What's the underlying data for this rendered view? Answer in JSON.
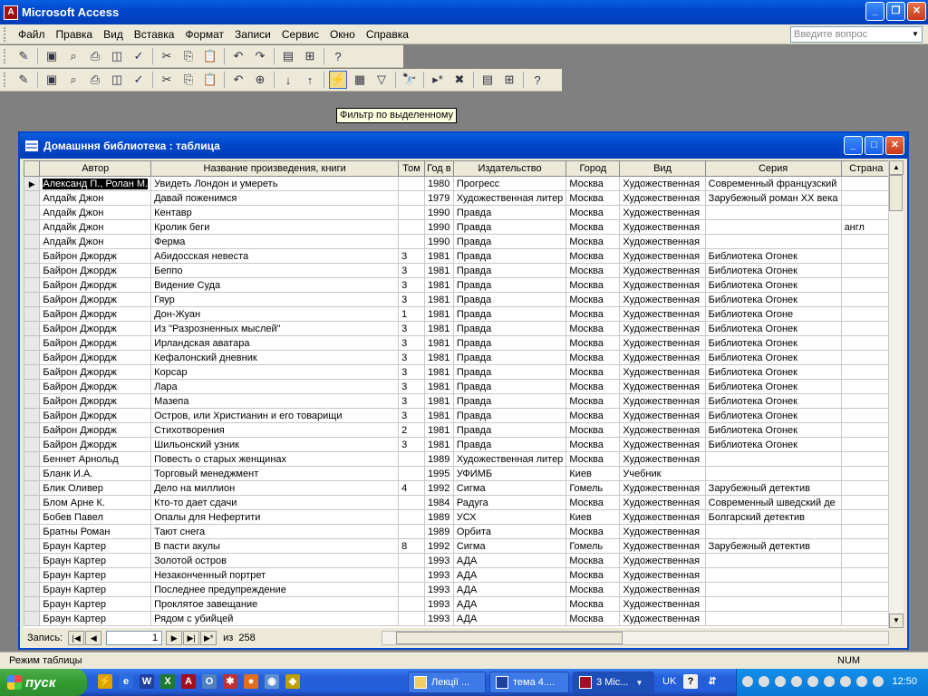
{
  "app": {
    "title": "Microsoft Access"
  },
  "menu": [
    "Файл",
    "Правка",
    "Вид",
    "Вставка",
    "Формат",
    "Записи",
    "Сервис",
    "Окно",
    "Справка"
  ],
  "ask": {
    "placeholder": "Введите вопрос"
  },
  "tooltip": "Фильтр по выделенному",
  "table_window": {
    "title": "Домашння библиотека : таблица"
  },
  "columns": [
    "Автор",
    "Название произведения, книги",
    "Том",
    "Год в",
    "Издательство",
    "Город",
    "Вид",
    "Серия",
    "Страна"
  ],
  "rows": [
    [
      "Александ П., Ролан М.",
      "Увидеть Лондон и умереть",
      "",
      "1980",
      "Прогресс",
      "Москва",
      "Художественная",
      "Современный французский",
      ""
    ],
    [
      "Апдайк Джон",
      "Давай поженимся",
      "",
      "1979",
      "Художественная литер",
      "Москва",
      "Художественная",
      "Зарубежный роман XX века",
      ""
    ],
    [
      "Апдайк Джон",
      "Кентавр",
      "",
      "1990",
      "Правда",
      "Москва",
      "Художественная",
      "",
      ""
    ],
    [
      "Апдайк Джон",
      "Кролик беги",
      "",
      "1990",
      "Правда",
      "Москва",
      "Художественная",
      "",
      "англ"
    ],
    [
      "Апдайк Джон",
      "Ферма",
      "",
      "1990",
      "Правда",
      "Москва",
      "Художественная",
      "",
      ""
    ],
    [
      "Байрон Джордж",
      "Абидосская невеста",
      "3",
      "1981",
      "Правда",
      "Москва",
      "Художественная",
      "Библиотека Огонек",
      ""
    ],
    [
      "Байрон Джордж",
      "Беппо",
      "3",
      "1981",
      "Правда",
      "Москва",
      "Художественная",
      "Библиотека Огонек",
      ""
    ],
    [
      "Байрон Джордж",
      "Видение Суда",
      "3",
      "1981",
      "Правда",
      "Москва",
      "Художественная",
      "Библиотека Огонек",
      ""
    ],
    [
      "Байрон Джордж",
      "Гяур",
      "3",
      "1981",
      "Правда",
      "Москва",
      "Художественная",
      "Библиотека Огонек",
      ""
    ],
    [
      "Байрон Джордж",
      "Дон-Жуан",
      "1",
      "1981",
      "Правда",
      "Москва",
      "Художественная",
      "Библиотека Огоне",
      ""
    ],
    [
      "Байрон Джордж",
      "Из \"Разрозненных мыслей\"",
      "3",
      "1981",
      "Правда",
      "Москва",
      "Художественная",
      "Библиотека Огонек",
      ""
    ],
    [
      "Байрон Джордж",
      "Ирландская аватара",
      "3",
      "1981",
      "Правда",
      "Москва",
      "Художественная",
      "Библиотека Огонек",
      ""
    ],
    [
      "Байрон Джордж",
      "Кефалонский дневник",
      "3",
      "1981",
      "Правда",
      "Москва",
      "Художественная",
      "Библиотека Огонек",
      ""
    ],
    [
      "Байрон Джордж",
      "Корсар",
      "3",
      "1981",
      "Правда",
      "Москва",
      "Художественная",
      "Библиотека Огонек",
      ""
    ],
    [
      "Байрон Джордж",
      "Лара",
      "3",
      "1981",
      "Правда",
      "Москва",
      "Художественная",
      "Библиотека Огонек",
      ""
    ],
    [
      "Байрон Джордж",
      "Мазепа",
      "3",
      "1981",
      "Правда",
      "Москва",
      "Художественная",
      "Библиотека Огонек",
      ""
    ],
    [
      "Байрон Джордж",
      "Остров, или Христианин и его товарищи",
      "3",
      "1981",
      "Правда",
      "Москва",
      "Художественная",
      "Библиотека Огонек",
      ""
    ],
    [
      "Байрон Джордж",
      "Стихотворения",
      "2",
      "1981",
      "Правда",
      "Москва",
      "Художественная",
      "Библиотека Огонек",
      ""
    ],
    [
      "Байрон Джордж",
      "Шильонский узник",
      "3",
      "1981",
      "Правда",
      "Москва",
      "Художественная",
      "Библиотека Огонек",
      ""
    ],
    [
      "Беннет Арнольд",
      "Повесть о старых женщинах",
      "",
      "1989",
      "Художественная литер",
      "Москва",
      "Художественная",
      "",
      ""
    ],
    [
      "Бланк И.А.",
      "Торговый менеджмент",
      "",
      "1995",
      "УФИМБ",
      "Киев",
      "Учебник",
      "",
      ""
    ],
    [
      "Блик Оливер",
      "Дело на миллион",
      "4",
      "1992",
      "Сигма",
      "Гомель",
      "Художественная",
      "Зарубежный детектив",
      ""
    ],
    [
      "Блом Арне К.",
      "Кто-то дает сдачи",
      "",
      "1984",
      "Радуга",
      "Москва",
      "Художественная",
      "Современный шведский де",
      ""
    ],
    [
      "Бобев Павел",
      "Опалы для Нефертити",
      "",
      "1989",
      "УСХ",
      "Киев",
      "Художественная",
      "Болгарский детектив",
      ""
    ],
    [
      "Братны Роман",
      "Тают снега",
      "",
      "1989",
      "Орбита",
      "Москва",
      "Художественная",
      "",
      ""
    ],
    [
      "Браун Картер",
      "В пасти акулы",
      "8",
      "1992",
      "Сигма",
      "Гомель",
      "Художественная",
      "Зарубежный детектив",
      ""
    ],
    [
      "Браун Картер",
      "Золотой остров",
      "",
      "1993",
      "АДА",
      "Москва",
      "Художественная",
      "",
      ""
    ],
    [
      "Браун Картер",
      "Незаконченный портрет",
      "",
      "1993",
      "АДА",
      "Москва",
      "Художественная",
      "",
      ""
    ],
    [
      "Браун Картер",
      "Последнее предупреждение",
      "",
      "1993",
      "АДА",
      "Москва",
      "Художественная",
      "",
      ""
    ],
    [
      "Браун Картер",
      "Проклятое завещание",
      "",
      "1993",
      "АДА",
      "Москва",
      "Художественная",
      "",
      ""
    ],
    [
      "Браун Картер",
      "Рядом с убийцей",
      "",
      "1993",
      "АДА",
      "Москва",
      "Художественная",
      "",
      ""
    ]
  ],
  "nav": {
    "label": "Запись:",
    "current": "1",
    "of": "из",
    "total": "258"
  },
  "status": {
    "mode": "Режим таблицы",
    "num": "NUM"
  },
  "taskbar": {
    "start": "пуск",
    "tasks": [
      "Лекції ...",
      "тема 4....",
      "3 Mic..."
    ],
    "lang": "UK",
    "clock": "12:50"
  }
}
